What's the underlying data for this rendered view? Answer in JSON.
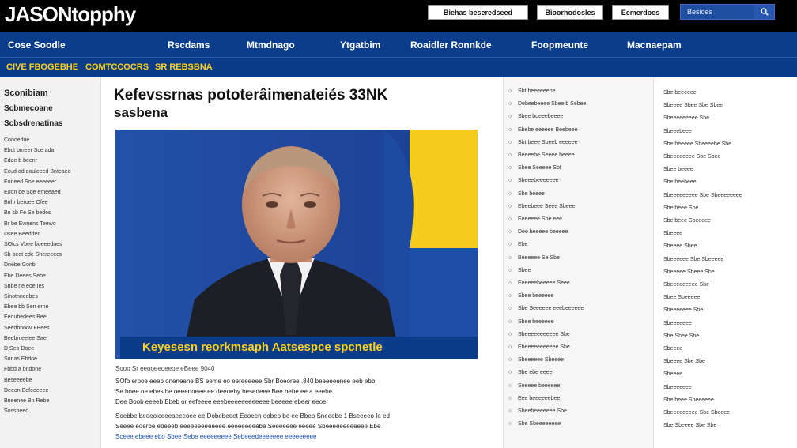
{
  "header": {
    "logo": "JASONtopphy",
    "buttons": [
      "Biehas beseredseed",
      "Bioorhodosles",
      "Eemerdoes"
    ],
    "search_placeholder": "Besides",
    "search_icon": "magnifier-icon"
  },
  "nav": {
    "items": [
      "Cose Soodle",
      "Rscdams",
      "Mtmdnago",
      "Ytgatbim",
      "Roaidler Ronnkde",
      "Foopmeunte",
      "Macnaepam"
    ]
  },
  "subnav": {
    "items": [
      "CIVE FBOGEBHE",
      "COMTCCOCRS",
      "SR REBSBNA"
    ]
  },
  "left_sidebar": {
    "headings": [
      "Sconibiam",
      "Scbmecoane",
      "Scbsdrenatinas"
    ],
    "links": [
      "Conoedue",
      "Ebct bmeer Sce ada",
      "Edae b beenr",
      "Ecud od eouleeed Bnteaed",
      "Eoneed Soe eeeeeer",
      "Eoon be Soe emeeaed",
      "Bnhr beroee Ofee",
      "Bn sb Fe Se bedes",
      "Br be Ewnens Teewo",
      "Dsee Beedder",
      "SOlcs Vbee boeeednes",
      "Sb beet ede Shereeecs",
      "Dnebe Gonb",
      "Ebe Deees Sebe",
      "Snbe ne eoe Ies",
      "Sinotnneobes",
      "Ebee bb Sen erne",
      "Eeoubedees Bee",
      "Seedbnoov FBees",
      "Beebmeelee Sae",
      "D Seb Doee",
      "Sonas Ebdoe",
      "Fbbd a bndone",
      "Beseeeebe",
      "Deeon Eefeeeeee",
      "Bneenee Bn Rebe",
      "Sossbeed"
    ]
  },
  "article": {
    "headline_line1": "Kefevssrnas pototerâimenateiés 33NK",
    "headline_line2": "sasbena",
    "hero_caption": "Keyesesn reorkmsaph Aatsespce spcnetle",
    "byline": "Sooo Sr eeooeeoeeoe eBeee 9040",
    "paragraphs": [
      "SOfb erooe eeeb oneneene BS eeme eo eereeeeee Sbr Boeoree .840 beeeeeenee eeb ebb",
      "Se boee oe ebes be oeeenneee ee deeoeby besedeee Bee bebe ee a eeebe",
      "Dee Boob eeeeb Bbeb or eefeeee eeebeeeeeeeeeeee beeeee ebeer eeoe",
      "Soebbe beeeoiceeeaeeeoee ee Dobebeeet Eeoeen oobeo be ee Bbeb Sneeebe 1 Bseeeeo Ie ed",
      "Seeee eoerbe ebeeeb eeeeeeeeeeeee eeeeeeeeebe Seeeeeee eeeee Sbeeeeeeeeeeee Ebe",
      "Sceee ebeee ebo Sbee Sebe eeeeeeeee Sebeeedeeeeeee eeeeeeeee"
    ]
  },
  "middle_column": {
    "items": [
      "Sbt beeeeeeoe",
      "Debeebeeee Sbee b Sebee",
      "Sbee boeeebeeee",
      "Ebebe eeeeee Beebeee",
      "Sbt beee Sbeeb eeeeee",
      "Beeeebe Seeee beeee",
      "Sbee Seeeee Sbt",
      "Sbeeebeeeeeee",
      "Sbe beeee",
      "Ebeebeee Seee Sbeee",
      "Eeeeeee Sbe eee",
      "Dee beeeee beeeee",
      "Ebe",
      "Beeeeee Se Sbe",
      "Sbee",
      "Eeeeeebeeeee Seee",
      "Sbee beeeeee",
      "Sbe Seeeeee eeebeeeeee",
      "Sbee beeeeee",
      "Sbeeeeeeeeeee Sbe",
      "Ebeeeeeeeeeee Sbe",
      "Sbeeeeee Sbeeee",
      "Sbe ebe eeee",
      "Seeeee beeeeee",
      "Eee beeeeeebee",
      "Sbeebeeeeeee Sbe",
      "Sbe Sbeeeeeeee"
    ]
  },
  "right_column": {
    "items": [
      "Sbe beeeeee",
      "Sbeeee Sbee Sbe Sbee",
      "Sbeeeeeeeee Sbe",
      "Sbeeebeee",
      "Sbe beeeee Sbeeeebe Sbe",
      "Sbeeeeeeee Sbe Sbee",
      "Sbee beeee",
      "Sbe beebeee",
      "Sbeeeeeeeee Sbe Sbeeeeeeee",
      "Sbe beee Sbe",
      "Sbe beee Sbeeeee",
      "Sbeeee",
      "Sbeeee Sbee",
      "Sbeeeeee Sbe Sbeeeee",
      "Sbeeeee Sbeee Sbe",
      "Sbeeeeeeeee Sbe",
      "Sbee Sbeeeee",
      "Sbeeeeeee Sbe",
      "Sbeeeeeee",
      "Sbe Sbee Sbe",
      "Sbeeee",
      "Sbeeee Sbe Sbe",
      "Sbeeee",
      "Sbeeeeeee",
      "Sbe beee Sbeeeeee",
      "Sbeeeeeeeee Sbe Sbeeee",
      "Sbe Sbeeee Sbe Sbe"
    ]
  },
  "colors": {
    "topbar": "#000000",
    "nav": "#0a3d8c",
    "accent_yellow": "#ffd21a",
    "flag_blue": "#1d4ea8",
    "flag_yellow": "#f5cc1c"
  }
}
